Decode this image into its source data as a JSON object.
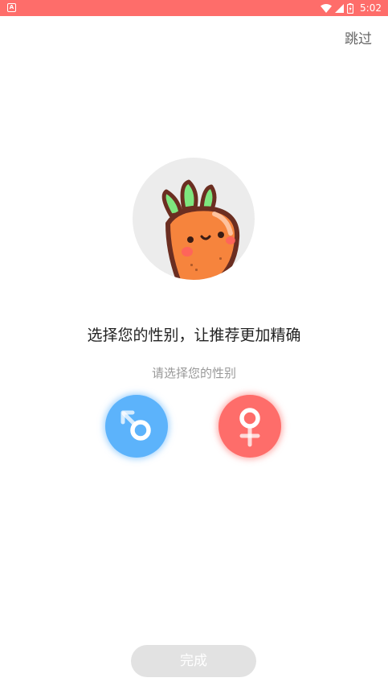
{
  "status_bar": {
    "time": "5:02",
    "background": "#fe6d6a",
    "icons": [
      "app-notification-icon",
      "wifi-icon",
      "signal-icon",
      "battery-icon"
    ]
  },
  "header": {
    "skip_label": "跳过"
  },
  "main": {
    "title": "选择您的性别，让推荐更加精确",
    "subtitle": "请选择您的性别",
    "gender_options": [
      {
        "icon": "male-symbol-icon",
        "color": "#5cb3fb"
      },
      {
        "icon": "female-symbol-icon",
        "color": "#fe6d6a"
      }
    ]
  },
  "footer": {
    "done_label": "完成",
    "done_color": "#e2e2e2"
  }
}
